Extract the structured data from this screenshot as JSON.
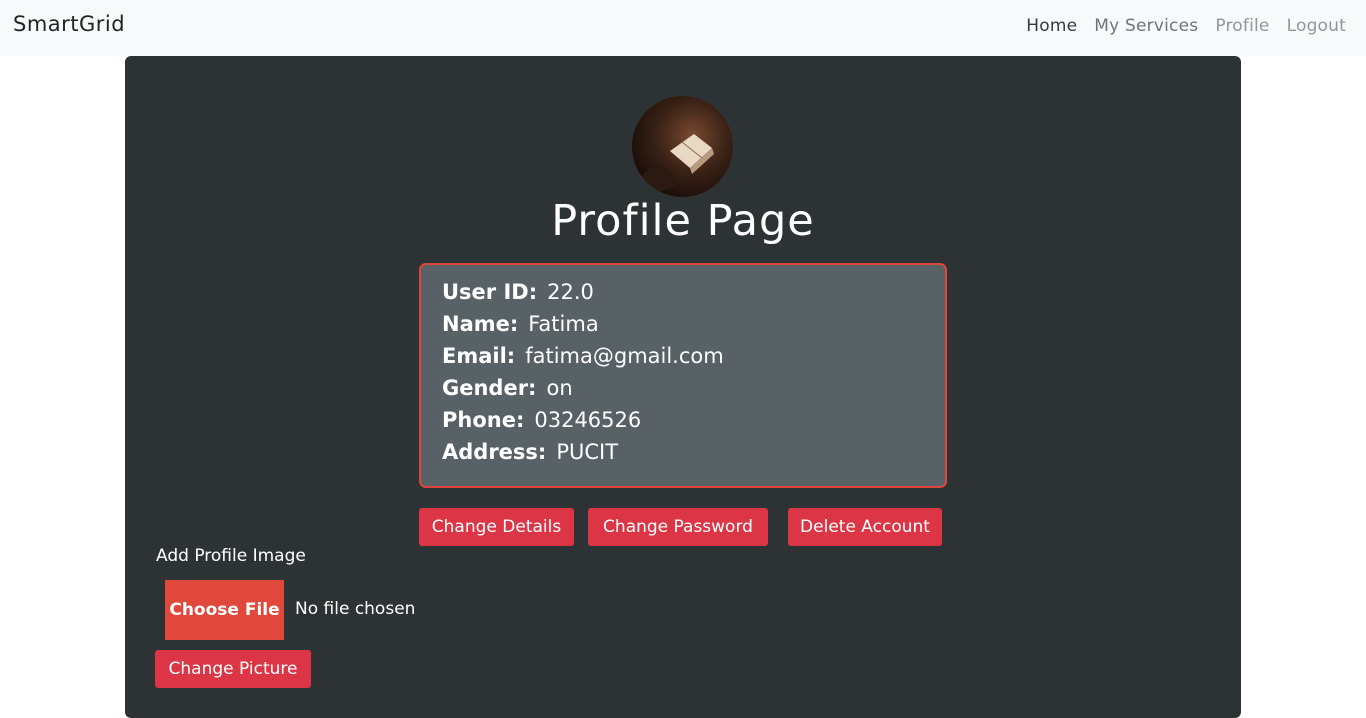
{
  "navbar": {
    "brand": "SmartGrid",
    "links": [
      {
        "label": "Home"
      },
      {
        "label": "My Services"
      },
      {
        "label": "Profile"
      },
      {
        "label": "Logout"
      }
    ]
  },
  "profile": {
    "title": "Profile Page",
    "fields": [
      {
        "label": "User ID:",
        "value": "22.0"
      },
      {
        "label": "Name:",
        "value": "Fatima"
      },
      {
        "label": "Email:",
        "value": "fatima@gmail.com"
      },
      {
        "label": "Gender:",
        "value": "on"
      },
      {
        "label": "Phone:",
        "value": "03246526"
      },
      {
        "label": "Address:",
        "value": "PUCIT"
      }
    ],
    "buttons": {
      "change_details": "Change Details",
      "change_password": "Change Password",
      "delete_account": "Delete Account"
    }
  },
  "upload": {
    "label": "Add Profile Image",
    "choose_file": "Choose File",
    "status": "No file chosen",
    "change_picture": "Change Picture"
  },
  "colors": {
    "accent": "#dc3545",
    "card_bg": "#2d3335",
    "info_bg": "#586266",
    "info_border": "#e0453c"
  }
}
